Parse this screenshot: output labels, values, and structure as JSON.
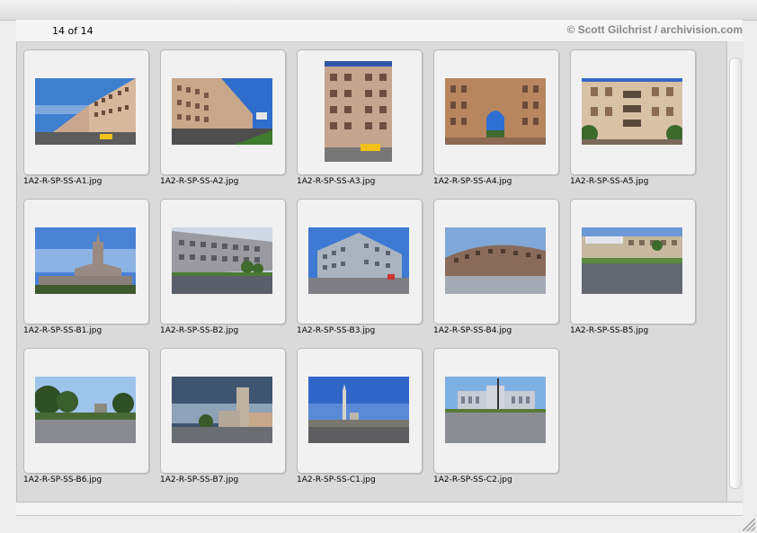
{
  "header": {
    "counter": "14 of 14",
    "credit": "© Scott Gilchrist / archivision.com"
  },
  "thumbnails": [
    {
      "filename": "1A2-R-SP-SS-A1.jpg",
      "icon": "apartment-building-street-photo"
    },
    {
      "filename": "1A2-R-SP-SS-A2.jpg",
      "icon": "apartment-building-street-photo"
    },
    {
      "filename": "1A2-R-SP-SS-A3.jpg",
      "icon": "apartment-facade-photo"
    },
    {
      "filename": "1A2-R-SP-SS-A4.jpg",
      "icon": "arched-gateway-building-photo"
    },
    {
      "filename": "1A2-R-SP-SS-A5.jpg",
      "icon": "balcony-facade-photo"
    },
    {
      "filename": "1A2-R-SP-SS-B1.jpg",
      "icon": "spired-tower-photo"
    },
    {
      "filename": "1A2-R-SP-SS-B2.jpg",
      "icon": "long-building-photo"
    },
    {
      "filename": "1A2-R-SP-SS-B3.jpg",
      "icon": "corner-building-photo"
    },
    {
      "filename": "1A2-R-SP-SS-B4.jpg",
      "icon": "curved-building-plaza-photo"
    },
    {
      "filename": "1A2-R-SP-SS-B5.jpg",
      "icon": "shopfront-street-photo"
    },
    {
      "filename": "1A2-R-SP-SS-B6.jpg",
      "icon": "trees-park-photo"
    },
    {
      "filename": "1A2-R-SP-SS-B7.jpg",
      "icon": "tower-storm-sky-photo"
    },
    {
      "filename": "1A2-R-SP-SS-C1.jpg",
      "icon": "obelisk-square-photo"
    },
    {
      "filename": "1A2-R-SP-SS-C2.jpg",
      "icon": "wide-plaza-building-photo"
    }
  ]
}
